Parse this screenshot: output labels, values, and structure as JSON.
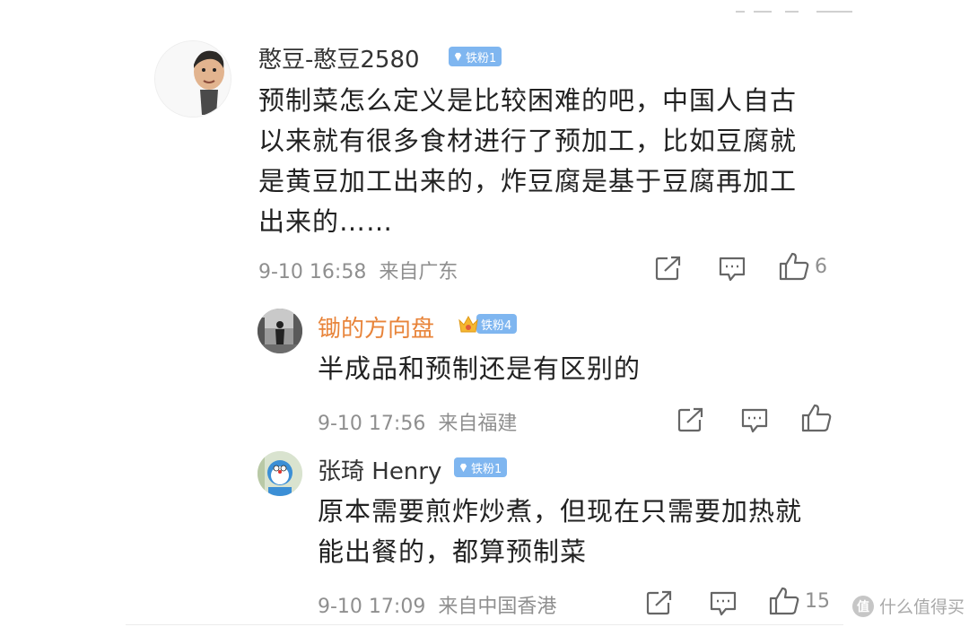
{
  "comments": [
    {
      "username": "憨豆-憨豆2580",
      "badge": "铁粉1",
      "lines": [
        "预制菜怎么定义是比较困难的吧，中国人自古",
        "以来就有很多食材进行了预加工，比如豆腐就",
        "是黄豆加工出来的，炸豆腐是基于豆腐再加工",
        "出来的……"
      ],
      "time": "9-10 16:58",
      "location": "来自广东",
      "likes": "6"
    },
    {
      "username": "锄的方向盘",
      "badge": "铁粉4",
      "lines": [
        "半成品和预制还是有区别的"
      ],
      "time": "9-10 17:56",
      "location": "来自福建",
      "likes": ""
    },
    {
      "username": "张琦 Henry",
      "badge": "铁粉1",
      "lines": [
        "原本需要煎炸炒煮，但现在只需要加热就",
        "能出餐的，都算预制菜"
      ],
      "time": "9-10 17:09",
      "location": "来自中国香港",
      "likes": "15"
    }
  ],
  "watermark": {
    "symbol": "值",
    "text": "什么值得买"
  },
  "colors": {
    "badge": "#7fb6f0",
    "username_highlight": "#e8843a",
    "meta": "#8f8f8f"
  },
  "icons": [
    "share-icon",
    "comment-icon",
    "like-icon",
    "crown-icon",
    "diamond-icon"
  ]
}
